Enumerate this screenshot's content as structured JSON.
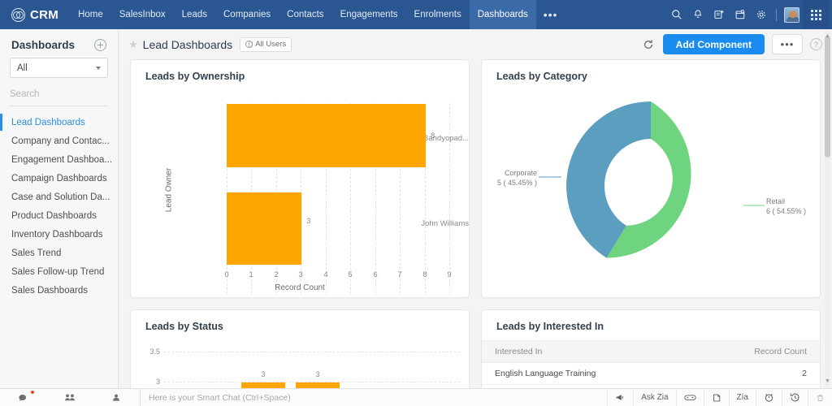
{
  "app": {
    "brand": "CRM",
    "brand_icon": "zoho-infinity-icon"
  },
  "topnav": {
    "items": [
      {
        "label": "Home",
        "active": false
      },
      {
        "label": "SalesInbox",
        "active": false
      },
      {
        "label": "Leads",
        "active": false
      },
      {
        "label": "Companies",
        "active": false
      },
      {
        "label": "Contacts",
        "active": false
      },
      {
        "label": "Engagements",
        "active": false
      },
      {
        "label": "Enrolments",
        "active": false
      },
      {
        "label": "Dashboards",
        "active": true
      }
    ],
    "more_label": "•••",
    "right_icons": [
      "search-icon",
      "bell-icon",
      "compose-note-icon",
      "calendar-add-icon",
      "settings-gear-icon"
    ],
    "avatar": "user-avatar",
    "app-switcher": "apps-grid-icon"
  },
  "sidebar": {
    "title": "Dashboards",
    "add_label": "+",
    "filter_value": "All",
    "search_placeholder": "Search",
    "items": [
      {
        "label": "Lead Dashboards",
        "active": true
      },
      {
        "label": "Company and Contac...",
        "active": false
      },
      {
        "label": "Engagement Dashboa...",
        "active": false
      },
      {
        "label": "Campaign Dashboards",
        "active": false
      },
      {
        "label": "Case and Solution Da...",
        "active": false
      },
      {
        "label": "Product Dashboards",
        "active": false
      },
      {
        "label": "Inventory Dashboards",
        "active": false
      },
      {
        "label": "Sales Trend",
        "active": false
      },
      {
        "label": "Sales Follow-up Trend",
        "active": false
      },
      {
        "label": "Sales Dashboards",
        "active": false
      }
    ],
    "collapse_label": "‹]"
  },
  "toolbar": {
    "page_title": "Lead Dashboards",
    "visibility_label": "All Users",
    "refresh_label": "↻",
    "add_component_label": "Add Component",
    "more_label": "•••",
    "help_label": "?"
  },
  "colors": {
    "nav_blue": "#2a5692",
    "accent_blue": "#1a8cf0",
    "bar_orange": "#ffa500",
    "donut_blue": "#5b9ec0",
    "donut_green": "#6ed47f",
    "link_blue": "#2a8fe0"
  },
  "cards": {
    "ownership": {
      "title": "Leads by Ownership"
    },
    "category": {
      "title": "Leads by Category"
    },
    "status": {
      "title": "Leads by Status"
    },
    "interested": {
      "title": "Leads by Interested In",
      "columns": [
        "Interested In",
        "Record Count"
      ],
      "rows": [
        {
          "label": "English Language Training",
          "count": "2"
        }
      ]
    }
  },
  "chart_data": [
    {
      "type": "bar",
      "orientation": "horizontal",
      "title": "Leads by Ownership",
      "categories": [
        "Arnab Bandyopad...",
        "John Williams"
      ],
      "values": [
        8,
        3
      ],
      "data_labels": [
        "8",
        "3"
      ],
      "xlabel": "Record Count",
      "ylabel": "Lead Owner",
      "xticks": [
        "0",
        "1",
        "2",
        "3",
        "4",
        "5",
        "6",
        "7",
        "8",
        "9"
      ],
      "xlim": [
        0,
        9
      ],
      "grid": true,
      "color": "#ffa500"
    },
    {
      "type": "pie",
      "variant": "donut",
      "title": "Leads by Category",
      "labels": [
        "Corporate",
        "Retail"
      ],
      "values": [
        5,
        6
      ],
      "percents": [
        "45.45%",
        "54.55%"
      ],
      "data_labels": [
        "Corporate\n5 ( 45.45% )",
        "Retail\n6 ( 54.55% )"
      ],
      "colors": [
        "#5b9ec0",
        "#6ed47f"
      ],
      "legend": "callout-labels"
    },
    {
      "type": "bar",
      "orientation": "vertical",
      "title": "Leads by Status",
      "categories": [
        "",
        ""
      ],
      "values": [
        3,
        3
      ],
      "data_labels": [
        "3",
        "3"
      ],
      "yticks": [
        "3.5",
        "3"
      ],
      "ylim": [
        0,
        3.5
      ],
      "grid": true,
      "color": "#ffa500",
      "note": "partially visible / clipped at viewport bottom"
    },
    {
      "type": "table",
      "title": "Leads by Interested In",
      "columns": [
        "Interested In",
        "Record Count"
      ],
      "rows": [
        [
          "English Language Training",
          2
        ]
      ]
    }
  ],
  "bottombar": {
    "left_icons": [
      {
        "name": "chats-icon",
        "label": "Chats",
        "badge": true
      },
      {
        "name": "channels-icon",
        "label": "Channels",
        "badge": false
      },
      {
        "name": "contacts-icon",
        "label": "Contacts",
        "badge": false
      }
    ],
    "chat_placeholder": "Here is your Smart Chat (Ctrl+Space)",
    "right_buttons": [
      {
        "name": "announcement-icon",
        "label": ""
      },
      {
        "name": "ask-zia-button",
        "label": "Ask Zia"
      },
      {
        "name": "gamescope-icon",
        "label": ""
      },
      {
        "name": "feed-icon",
        "label": ""
      },
      {
        "name": "zia-voice-icon",
        "label": "Zía"
      },
      {
        "name": "alarm-clock-icon",
        "label": ""
      },
      {
        "name": "recent-history-icon",
        "label": ""
      },
      {
        "name": "trash-icon",
        "label": ""
      }
    ]
  }
}
